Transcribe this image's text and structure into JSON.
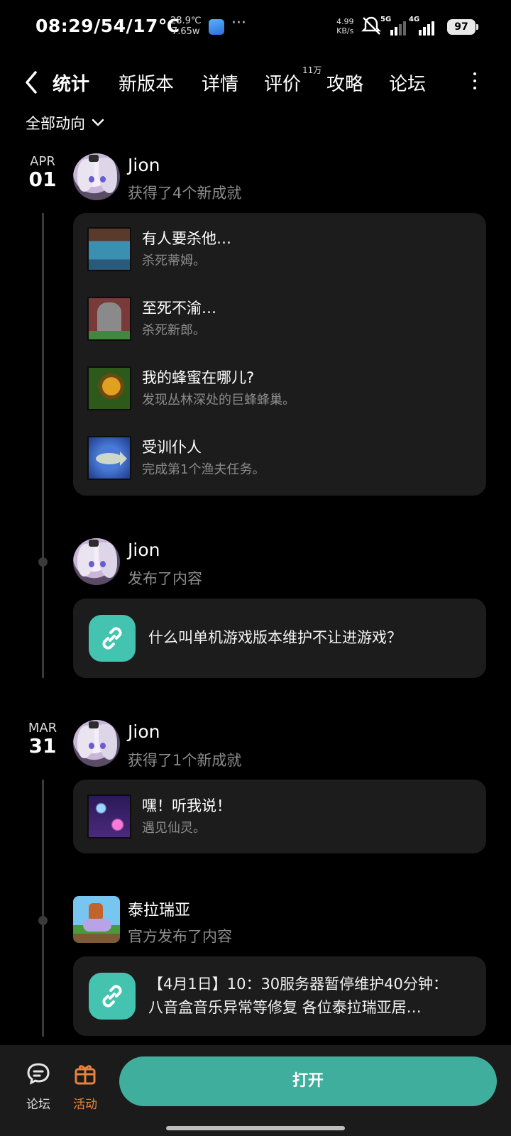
{
  "status_bar": {
    "time": "08:29/54/17℃",
    "temp_top": "28.9℃",
    "temp_bottom": "7.65w",
    "net_speed_value": "4.99",
    "net_speed_unit": "KB/s",
    "signal1_label": "5G",
    "signal2_label": "4G",
    "battery": "97"
  },
  "nav": {
    "tabs": [
      {
        "label": "统计",
        "active": true
      },
      {
        "label": "新版本"
      },
      {
        "label": "详情"
      },
      {
        "label": "评价"
      },
      {
        "label": "攻略"
      },
      {
        "label": "论坛"
      }
    ],
    "review_badge": "11万"
  },
  "filter": {
    "label": "全部动向"
  },
  "feed": [
    {
      "date_month": "APR",
      "date_day": "01",
      "user": "Jion",
      "action": "获得了4个新成就",
      "achievements": [
        {
          "title": "有人要杀他…",
          "desc": "杀死蒂姆。",
          "icon": "wizard-tim-icon"
        },
        {
          "title": "至死不渝…",
          "desc": "杀死新郎。",
          "icon": "tombstone-icon"
        },
        {
          "title": "我的蜂蜜在哪儿?",
          "desc": "发现丛林深处的巨蜂蜂巢。",
          "icon": "bee-hive-icon"
        },
        {
          "title": "受训仆人",
          "desc": "完成第1个渔夫任务。",
          "icon": "fish-icon"
        }
      ]
    },
    {
      "user": "Jion",
      "action": "发布了内容",
      "link_text": "什么叫单机游戏版本维护不让进游戏？"
    },
    {
      "date_month": "MAR",
      "date_day": "31",
      "user": "Jion",
      "action": "获得了1个新成就",
      "achievements": [
        {
          "title": "嘿！听我说！",
          "desc": "遇见仙灵。",
          "icon": "fairy-sparkle-icon"
        }
      ]
    },
    {
      "user": "泰拉瑞亚",
      "action": "官方发布了内容",
      "link_line1": "【4月1日】10：30服务器暂停维护40分钟：",
      "link_line2": "八音盒音乐异常等修复 各位泰拉瑞亚居…"
    }
  ],
  "bottom_bar": {
    "forum_label": "论坛",
    "event_label": "活动",
    "open_label": "打开"
  },
  "colors": {
    "accent": "#3fae9c",
    "active_tab_underline": "#3fb7a1",
    "event_orange": "#e8823c",
    "card_bg": "#1c1c1c"
  }
}
